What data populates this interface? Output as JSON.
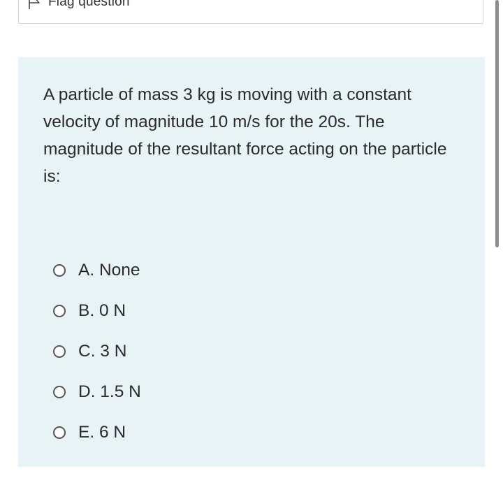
{
  "flag": {
    "label": "Flag question",
    "icon": "flag-icon"
  },
  "question": {
    "text": "A particle of mass 3 kg is moving with a constant velocity of magnitude 10 m/s for the 20s. The magnitude of the resultant force acting on the particle is:"
  },
  "answers": [
    {
      "label": "A. None",
      "selected": false
    },
    {
      "label": "B. 0 N",
      "selected": false
    },
    {
      "label": "C. 3 N",
      "selected": false
    },
    {
      "label": "D. 1.5 N",
      "selected": false
    },
    {
      "label": "E. 6 N",
      "selected": false
    }
  ],
  "colors": {
    "panel_background": "#e7f3f5",
    "box_border": "#cfd4d8",
    "text": "#2b2b2b",
    "scrollbar": "#8e8e8e"
  }
}
